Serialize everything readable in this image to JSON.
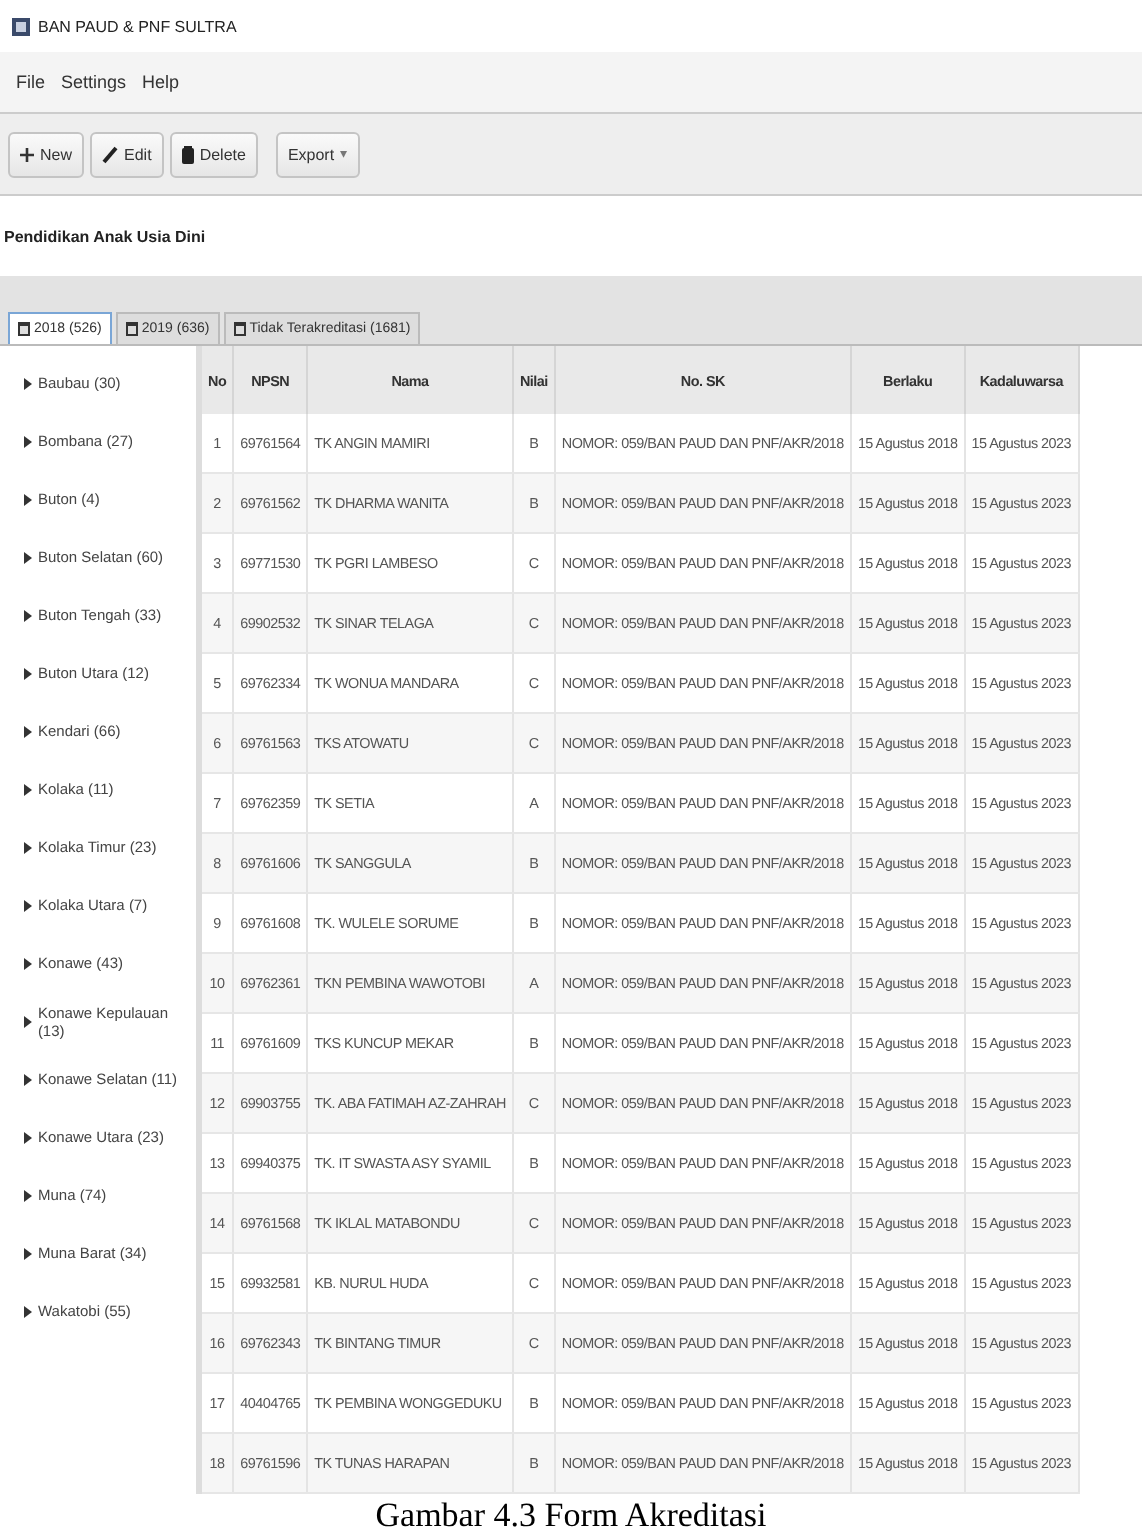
{
  "window": {
    "title": "BAN PAUD & PNF SULTRA"
  },
  "menu": [
    "File",
    "Settings",
    "Help"
  ],
  "toolbar": [
    {
      "kind": "new",
      "label": "New"
    },
    {
      "kind": "edit",
      "label": "Edit"
    },
    {
      "kind": "delete",
      "label": "Delete"
    },
    {
      "kind": "export",
      "label": "Export",
      "caret": "▾"
    }
  ],
  "heading": "Pendidikan Anak Usia Dini",
  "tabs": [
    {
      "label": "2018 (526)",
      "selected": true
    },
    {
      "label": "2019 (636)",
      "selected": false
    },
    {
      "label": "Tidak Terakreditasi (1681)",
      "selected": false
    }
  ],
  "sidebar": {
    "items": [
      {
        "label": "Baubau (30)",
        "expanded": false
      },
      {
        "label": "Bombana (27)",
        "expanded": false
      },
      {
        "label": "Buton (4)",
        "expanded": false
      },
      {
        "label": "Buton Selatan (60)",
        "expanded": false
      },
      {
        "label": "Buton Tengah (33)",
        "expanded": false
      },
      {
        "label": "Buton Utara (12)",
        "expanded": false
      },
      {
        "label": "Kendari (66)",
        "expanded": false
      },
      {
        "label": "Kolaka (11)",
        "expanded": false
      },
      {
        "label": "Kolaka Timur (23)",
        "expanded": false
      },
      {
        "label": "Kolaka Utara (7)",
        "expanded": false
      },
      {
        "label": "Konawe (43)",
        "expanded": false
      },
      {
        "label": "Konawe Kepulauan (13)",
        "expanded": false
      },
      {
        "label": "Konawe Selatan (11)",
        "expanded": false
      },
      {
        "label": "Konawe Utara (23)",
        "expanded": false
      },
      {
        "label": "Muna (74)",
        "expanded": false
      },
      {
        "label": "Muna Barat (34)",
        "expanded": false
      },
      {
        "label": "Wakatobi (55)",
        "expanded": false
      }
    ]
  },
  "table": {
    "columns": [
      "No",
      "NPSN",
      "Nama",
      "Nilai",
      "No. SK",
      "Berlaku",
      "Kadaluwarsa"
    ],
    "rows": [
      [
        "1",
        "69761564",
        "TK ANGIN MAMIRI",
        "B",
        "NOMOR: 059/BAN PAUD DAN PNF/AKR/2018",
        "15 Agustus 2018",
        "15 Agustus 2023"
      ],
      [
        "2",
        "69761562",
        "TK DHARMA WANITA",
        "B",
        "NOMOR: 059/BAN PAUD DAN PNF/AKR/2018",
        "15 Agustus 2018",
        "15 Agustus 2023"
      ],
      [
        "3",
        "69771530",
        "TK PGRI LAMBESO",
        "C",
        "NOMOR: 059/BAN PAUD DAN PNF/AKR/2018",
        "15 Agustus 2018",
        "15 Agustus 2023"
      ],
      [
        "4",
        "69902532",
        "TK SINAR TELAGA",
        "C",
        "NOMOR: 059/BAN PAUD DAN PNF/AKR/2018",
        "15 Agustus 2018",
        "15 Agustus 2023"
      ],
      [
        "5",
        "69762334",
        "TK WONUA MANDARA",
        "C",
        "NOMOR: 059/BAN PAUD DAN PNF/AKR/2018",
        "15 Agustus 2018",
        "15 Agustus 2023"
      ],
      [
        "6",
        "69761563",
        "TKS ATOWATU",
        "C",
        "NOMOR: 059/BAN PAUD DAN PNF/AKR/2018",
        "15 Agustus 2018",
        "15 Agustus 2023"
      ],
      [
        "7",
        "69762359",
        "TK SETIA",
        "A",
        "NOMOR: 059/BAN PAUD DAN PNF/AKR/2018",
        "15 Agustus 2018",
        "15 Agustus 2023"
      ],
      [
        "8",
        "69761606",
        "TK SANGGULA",
        "B",
        "NOMOR: 059/BAN PAUD DAN PNF/AKR/2018",
        "15 Agustus 2018",
        "15 Agustus 2023"
      ],
      [
        "9",
        "69761608",
        "TK. WULELE SORUME",
        "B",
        "NOMOR: 059/BAN PAUD DAN PNF/AKR/2018",
        "15 Agustus 2018",
        "15 Agustus 2023"
      ],
      [
        "10",
        "69762361",
        "TKN PEMBINA WAWOTOBI",
        "A",
        "NOMOR: 059/BAN PAUD DAN PNF/AKR/2018",
        "15 Agustus 2018",
        "15 Agustus 2023"
      ],
      [
        "11",
        "69761609",
        "TKS KUNCUP MEKAR",
        "B",
        "NOMOR: 059/BAN PAUD DAN PNF/AKR/2018",
        "15 Agustus 2018",
        "15 Agustus 2023"
      ],
      [
        "12",
        "69903755",
        "TK. ABA FATIMAH AZ-ZAHRAH",
        "C",
        "NOMOR: 059/BAN PAUD DAN PNF/AKR/2018",
        "15 Agustus 2018",
        "15 Agustus 2023"
      ],
      [
        "13",
        "69940375",
        "TK. IT SWASTA ASY SYAMIL",
        "B",
        "NOMOR: 059/BAN PAUD DAN PNF/AKR/2018",
        "15 Agustus 2018",
        "15 Agustus 2023"
      ],
      [
        "14",
        "69761568",
        "TK IKLAL MATABONDU",
        "C",
        "NOMOR: 059/BAN PAUD DAN PNF/AKR/2018",
        "15 Agustus 2018",
        "15 Agustus 2023"
      ],
      [
        "15",
        "69932581",
        "KB. NURUL HUDA",
        "C",
        "NOMOR: 059/BAN PAUD DAN PNF/AKR/2018",
        "15 Agustus 2018",
        "15 Agustus 2023"
      ],
      [
        "16",
        "69762343",
        "TK BINTANG TIMUR",
        "C",
        "NOMOR: 059/BAN PAUD DAN PNF/AKR/2018",
        "15 Agustus 2018",
        "15 Agustus 2023"
      ],
      [
        "17",
        "40404765",
        "TK PEMBINA WONGGEDUKU",
        "B",
        "NOMOR: 059/BAN PAUD DAN PNF/AKR/2018",
        "15 Agustus 2018",
        "15 Agustus 2023"
      ],
      [
        "18",
        "69761596",
        "TK TUNAS HARAPAN",
        "B",
        "NOMOR: 059/BAN PAUD DAN PNF/AKR/2018",
        "15 Agustus 2018",
        "15 Agustus 2023"
      ]
    ]
  },
  "caption": "Gambar 4.3 Form Akreditasi"
}
